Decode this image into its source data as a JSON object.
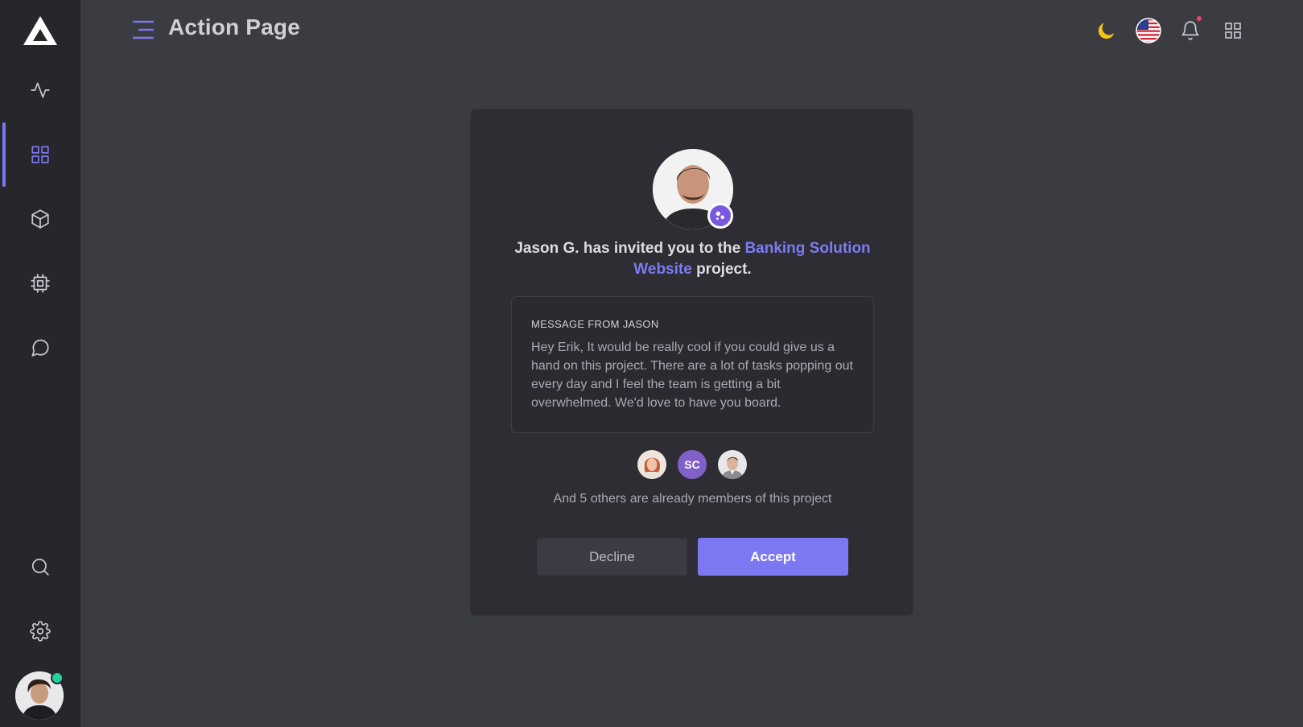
{
  "header": {
    "title": "Action Page"
  },
  "sidebar": {
    "items": [
      {
        "id": "activity",
        "icon": "activity-icon"
      },
      {
        "id": "dashboard",
        "icon": "grid-icon",
        "active": true
      },
      {
        "id": "box",
        "icon": "box-icon"
      },
      {
        "id": "cpu",
        "icon": "cpu-icon"
      },
      {
        "id": "messages",
        "icon": "message-icon"
      },
      {
        "id": "search",
        "icon": "search-icon"
      },
      {
        "id": "settings",
        "icon": "gear-icon"
      }
    ]
  },
  "invite": {
    "prefix": "Jason G. has invited you to the ",
    "project_name": "Banking Solution Website",
    "suffix": " project.",
    "message_title": "MESSAGE FROM JASON",
    "message_body": "Hey Erik, It would be really cool if you could give us a hand on this project. There are a lot of tasks popping out every day and I feel the team is getting a bit overwhelmed. We'd love to have you board.",
    "member_initials": "SC",
    "members_text": "And 5 others are already members of this project",
    "decline_label": "Decline",
    "accept_label": "Accept"
  },
  "colors": {
    "accent": "#7b78f1",
    "background": "#3b3b42",
    "sidebar": "#26262b",
    "card": "#2d2d33",
    "online": "#1fd19b"
  }
}
